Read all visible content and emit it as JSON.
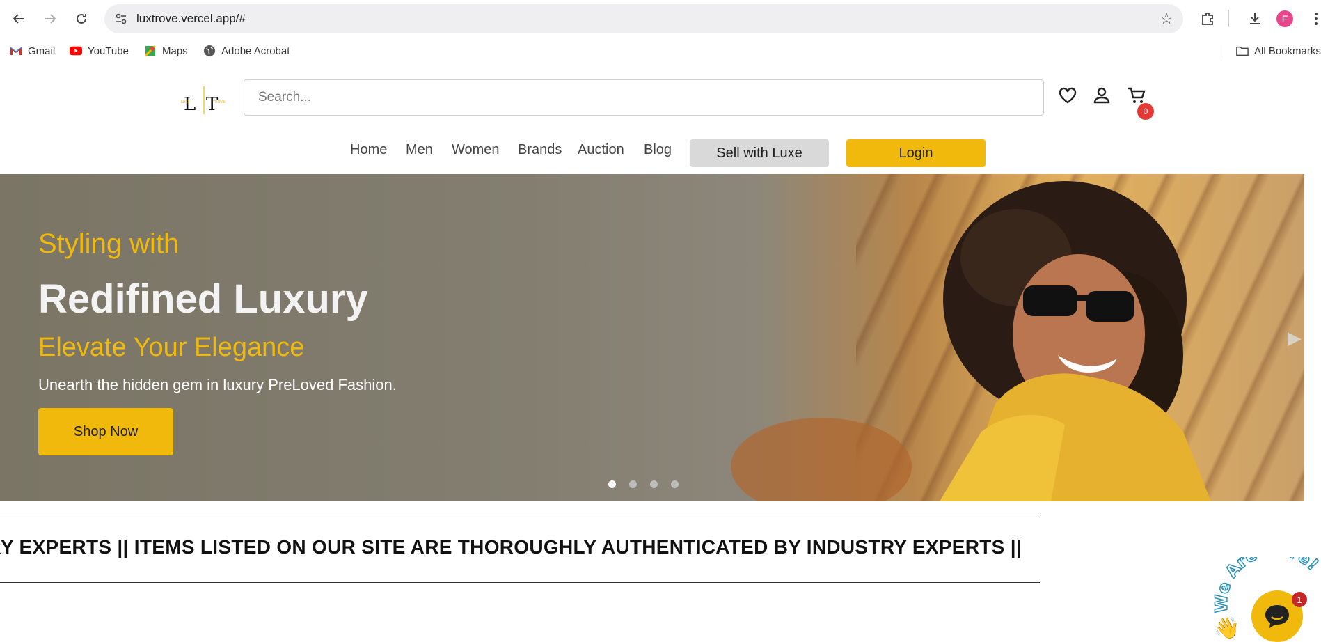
{
  "browser": {
    "url": "luxtrove.vercel.app/#",
    "profile_initial": "F",
    "bookmarks": [
      "Gmail",
      "YouTube",
      "Maps",
      "Adobe Acrobat"
    ],
    "all_bookmarks": "All Bookmarks"
  },
  "header": {
    "search_placeholder": "Search...",
    "cart_count": "0",
    "nav": [
      "Home",
      "Men",
      "Women",
      "Brands",
      "Auction",
      "Blog"
    ],
    "sell_label": "Sell with Luxe",
    "login_label": "Login"
  },
  "hero": {
    "subtitle": "Styling with",
    "title": "Redifined Luxury",
    "tagline": "Elevate Your Elegance",
    "description": "Unearth the hidden gem in luxury PreLoved Fashion.",
    "cta_label": "Shop Now",
    "slide_count": 4,
    "active_slide": 1
  },
  "marquee": {
    "text": "RY EXPERTS || ITEMS LISTED ON OUR SITE ARE THOROUGHLY AUTHENTICATED BY INDUSTRY EXPERTS ||"
  },
  "chat": {
    "label": "We Are Here!",
    "unread": "1"
  },
  "colors": {
    "accent": "#f0b90b",
    "badge": "#e53935"
  }
}
